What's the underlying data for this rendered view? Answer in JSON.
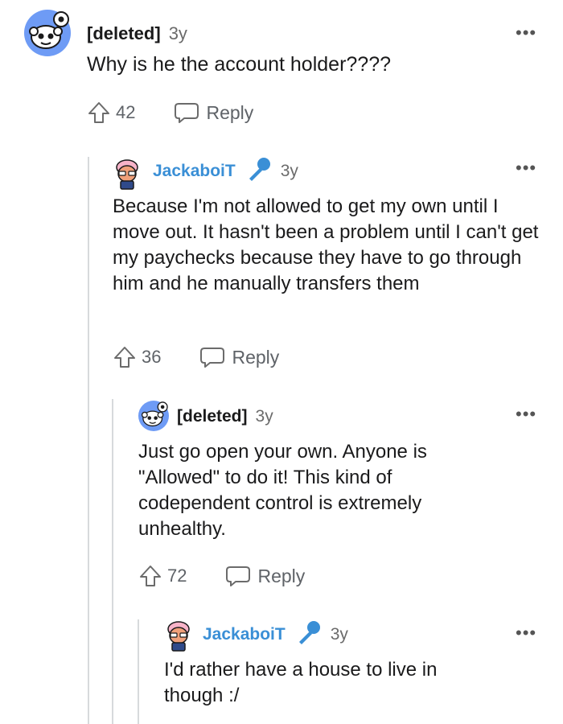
{
  "comments": [
    {
      "user": "[deleted]",
      "age": "3y",
      "body": "Why is he the account holder????",
      "votes": "42",
      "reply": "Reply",
      "more": "•••"
    },
    {
      "user": "JackaboiT",
      "age": "3y",
      "body": "Because I'm not allowed to get my own until I move out. It hasn't been a problem until I can't get my paychecks because they have to go through him and he manually transfers them",
      "votes": "36",
      "reply": "Reply",
      "more": "•••"
    },
    {
      "user": "[deleted]",
      "age": "3y",
      "body": "Just go open your own. Anyone is \"Allowed\" to do it! This kind of codependent control is extremely unhealthy.",
      "votes": "72",
      "reply": "Reply",
      "more": "•••"
    },
    {
      "user": "JackaboiT",
      "age": "3y",
      "body": "I'd rather have a house to live in though :/",
      "more": "•••"
    }
  ],
  "colors": {
    "accent": "#3a8fd6",
    "rail": "#d7dadc",
    "muted": "#6b6b6b"
  }
}
